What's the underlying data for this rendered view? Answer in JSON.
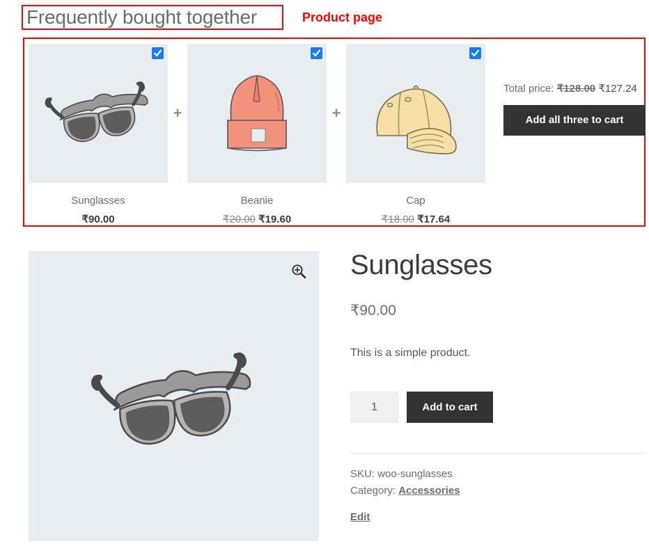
{
  "annotations": {
    "heading_box_color": "#ff0000",
    "section_box_color": "#ff0000",
    "product_page_label": "Product page"
  },
  "frequently_bought_together": {
    "heading": "Frequently bought together",
    "separator": "+",
    "items": [
      {
        "name": "Sunglasses",
        "image": "sunglasses-image",
        "checkbox_checked": true,
        "regular_price": "",
        "price": "₹90.00"
      },
      {
        "name": "Beanie",
        "image": "beanie-image",
        "checkbox_checked": true,
        "regular_price": "₹20.00",
        "price": "₹19.60"
      },
      {
        "name": "Cap",
        "image": "cap-image",
        "checkbox_checked": true,
        "regular_price": "₹18.00",
        "price": "₹17.64"
      }
    ],
    "total_label": "Total price:",
    "total_regular": "₹128.00",
    "total_price": "₹127.24",
    "add_all_button": "Add all three to cart"
  },
  "product": {
    "title": "Sunglasses",
    "price": "₹90.00",
    "description": "This is a simple product.",
    "quantity_value": "1",
    "quantity_placeholder": "1",
    "add_to_cart_button": "Add to cart",
    "zoom_icon": "zoom-in-icon",
    "gallery_image": "sunglasses-image",
    "sku_label": "SKU:",
    "sku_value": "woo-sunglasses",
    "category_label": "Category:",
    "category_value": "Accessories",
    "edit_link": "Edit"
  },
  "colors": {
    "accent_red": "#ff0000",
    "checkbox_blue": "#1a7bf0",
    "button_dark": "#333333",
    "image_bg": "#e8edf2",
    "edit_link": "#9b59c9"
  }
}
